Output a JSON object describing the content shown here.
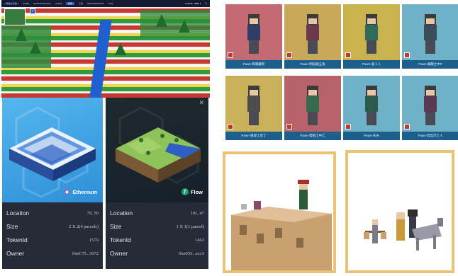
{
  "game_panel": {
    "logo": "Ξ 网易元宇宙 ▾",
    "nav": [
      "HOME",
      "MARKETPLACE ▾",
      "CLAIM",
      "工具",
      "MAINTENANCE ▾",
      "FAQ"
    ],
    "active_nav": "领地",
    "account": "0x4cC3...3B04 ▾",
    "badge": "+"
  },
  "cards": [
    {
      "chain": "Ethereum",
      "accent": "#4aa3e6",
      "fields": [
        {
          "key": "Location",
          "value": "79, 50"
        },
        {
          "key": "Size",
          "value": "2 X 2(4 parcels)"
        },
        {
          "key": "TokenId",
          "value": "1579"
        },
        {
          "key": "Owner",
          "value": "0xeC7f...3972"
        }
      ]
    },
    {
      "chain": "Flow",
      "accent": "#1aa772",
      "close": "✕",
      "fields": [
        {
          "key": "Location",
          "value": "101, 47"
        },
        {
          "key": "Size",
          "value": "1 X 1(1 parcel)"
        },
        {
          "key": "TokenId",
          "value": "1463"
        },
        {
          "key": "Owner",
          "value": "0xe033...ecc3"
        }
      ]
    }
  ],
  "pawns": [
    {
      "label": "Pawn-筒端藏育",
      "bg": "#c46a72",
      "body": "#2d3f66"
    },
    {
      "label": "Pawn-明稻融五角",
      "bg": "#c8a95a",
      "body": "#6a3a4c"
    },
    {
      "label": "Pawn-道十人",
      "bg": "#c8b34e",
      "body": "#2f6b5a"
    },
    {
      "label": "Pawn-酬酬士中P",
      "bg": "#6fb2c7",
      "body": "#3a4c5a"
    },
    {
      "label": "Pawn-佩郎士卒丁",
      "bg": "#c9b05a",
      "body": "#4d4d4d"
    },
    {
      "label": "Pawn-碧狼士中乙",
      "bg": "#b8626c",
      "body": "#3a6a4c"
    },
    {
      "label": "Pawn-乐天",
      "bg": "#6fb2c7",
      "body": "#2d5a4c"
    },
    {
      "label": "Pawn-碧晶交士人",
      "bg": "#6fb2c7",
      "body": "#5a3a52"
    }
  ]
}
